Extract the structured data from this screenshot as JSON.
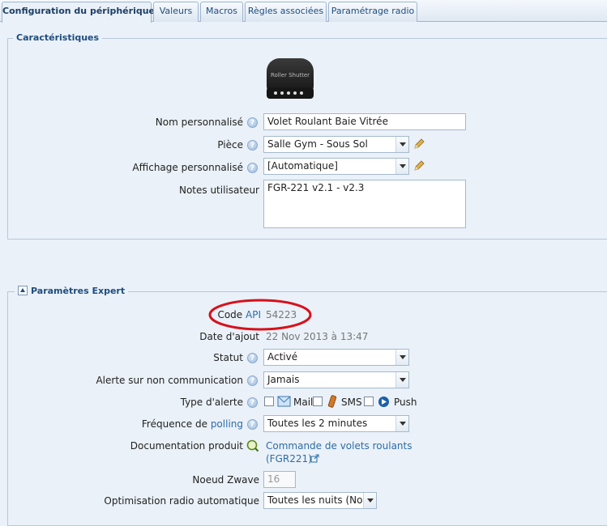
{
  "tabs": [
    {
      "label": "Configuration du périphérique",
      "active": true
    },
    {
      "label": "Valeurs"
    },
    {
      "label": "Macros"
    },
    {
      "label": "Règles associées"
    },
    {
      "label": "Paramétrage radio"
    }
  ],
  "characteristics": {
    "title": "Caractéristiques",
    "device_image_text": "Roller Shutter",
    "name_label": "Nom personnalisé",
    "name_value": "Volet Roulant Baie Vitrée",
    "room_label": "Pièce",
    "room_value": "Salle Gym - Sous Sol",
    "display_label": "Affichage personnalisé",
    "display_value": "[Automatique]",
    "notes_label": "Notes utilisateur",
    "notes_value": "FGR-221 v2.1 - v2.3"
  },
  "expert": {
    "title": "Paramètres Expert",
    "api_label_prefix": "Code",
    "api_label_link": "API",
    "api_value": "54223",
    "date_label": "Date d'ajout",
    "date_value": "22 Nov 2013 à 13:47",
    "status_label": "Statut",
    "status_value": "Activé",
    "alert_label": "Alerte sur non communication",
    "alert_value": "Jamais",
    "alert_type_label": "Type d'alerte",
    "alert_types": [
      "Mail",
      "SMS",
      "Push"
    ],
    "polling_label_prefix": "Fréquence de",
    "polling_label_link": "polling",
    "polling_value": "Toutes les 2 minutes",
    "doc_label": "Documentation produit",
    "doc_link_line1": "Commande de volets roulants",
    "doc_link_line2": "(FGR221)",
    "zwave_label": "Noeud Zwave",
    "zwave_value": "16",
    "radio_opt_label": "Optimisation radio automatique",
    "radio_opt_value": "Toutes les nuits (Nor"
  },
  "colors": {
    "background": "#eaf1f8",
    "accent": "#1f4d7f",
    "highlight_circle": "#d7111b"
  }
}
